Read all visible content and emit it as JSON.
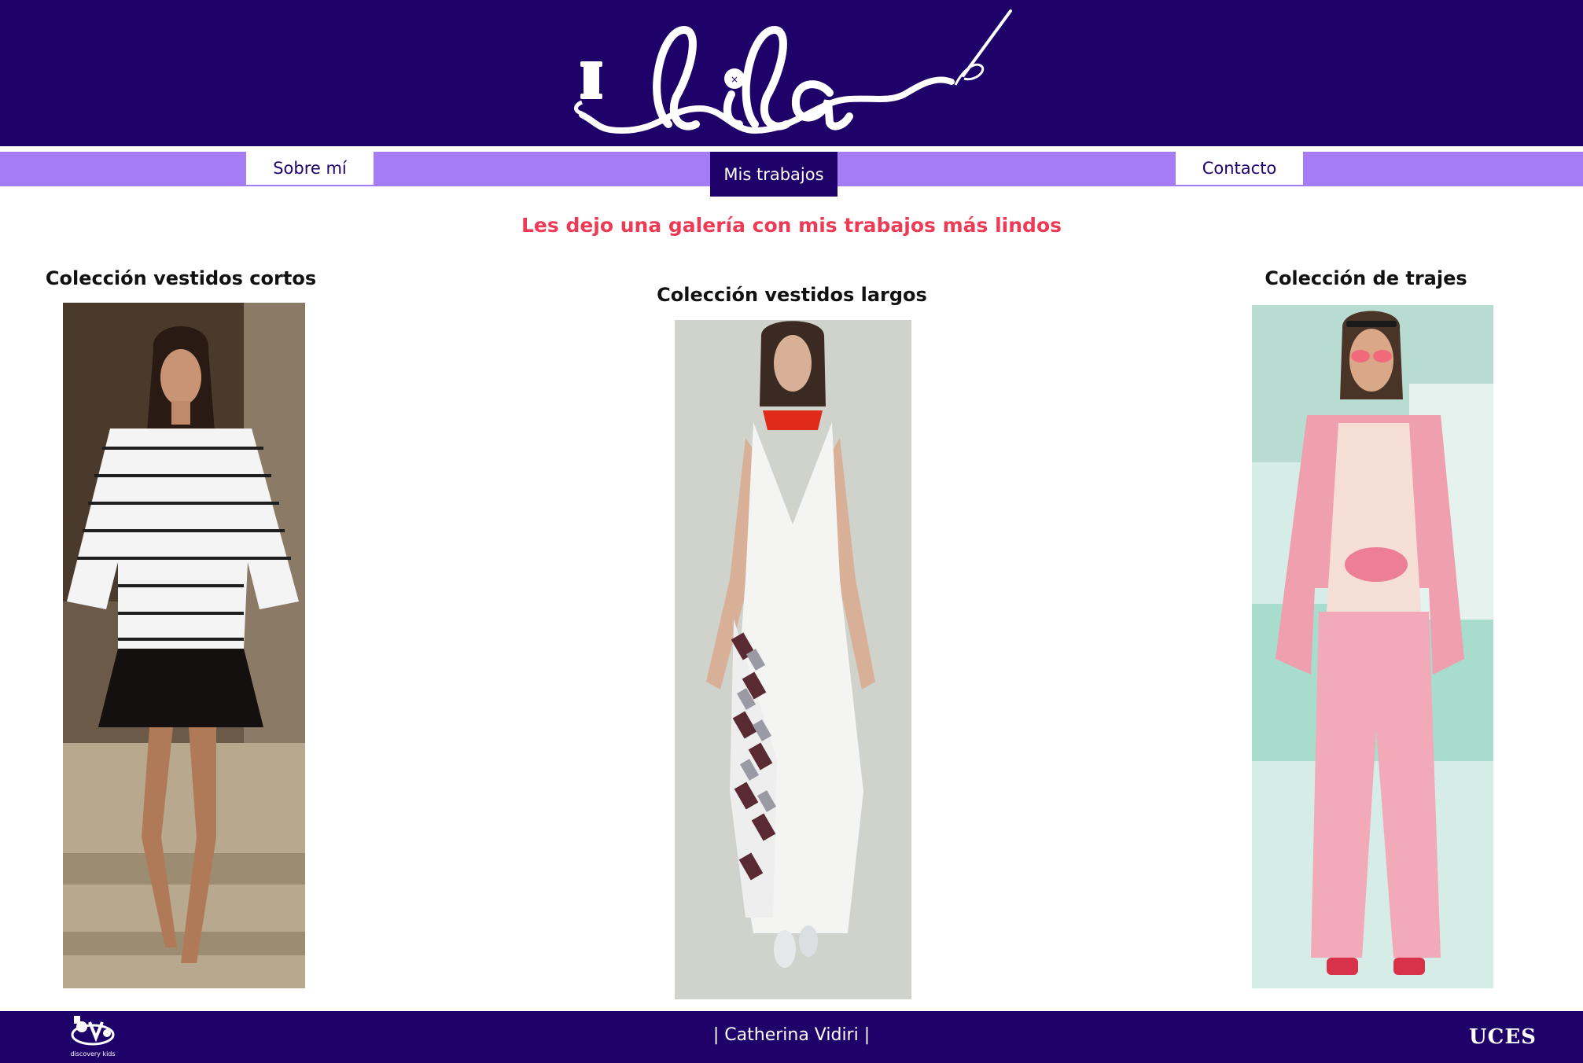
{
  "brand": {
    "logo_text": "lila",
    "color_primary": "#1f0269",
    "color_nav": "#a67cf6",
    "color_accent": "#ed3a55"
  },
  "nav": {
    "items": [
      {
        "label": "Sobre mí",
        "active": false
      },
      {
        "label": "Mis trabajos",
        "active": true
      },
      {
        "label": "Contacto",
        "active": false
      }
    ]
  },
  "main": {
    "subtitle": "Les dejo una galería con mis trabajos más lindos",
    "collections": [
      {
        "title": "Colección vestidos cortos"
      },
      {
        "title": "Colección vestidos largos"
      },
      {
        "title": "Colección de trajes"
      }
    ]
  },
  "footer": {
    "credit": "| Catherina Vidiri |",
    "left_logo_text": "discovery kids",
    "right_logo_text": "UCES"
  }
}
